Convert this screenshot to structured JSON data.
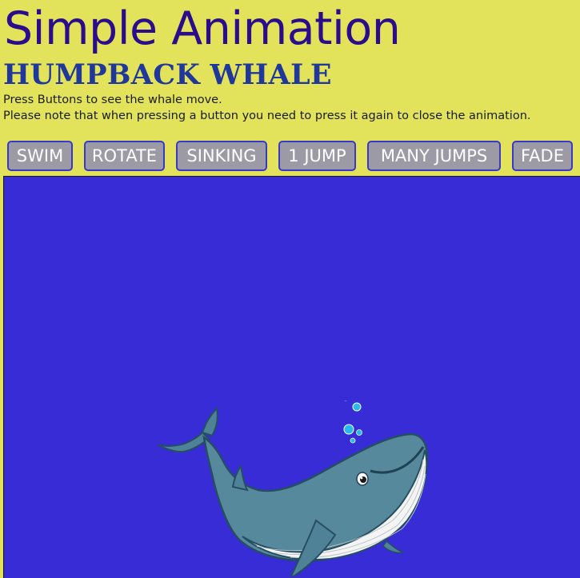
{
  "header": {
    "title": "Simple Animation",
    "subtitle": "HUMPBACK WHALE",
    "instructions": [
      "Press Buttons to see the whale move.",
      "Please note that when pressing a button you need to press it again to close the animation."
    ]
  },
  "controls": {
    "buttons": [
      {
        "label": "SWIM"
      },
      {
        "label": "ROTATE"
      },
      {
        "label": "SINKING"
      },
      {
        "label": "1 JUMP"
      },
      {
        "label": "MANY JUMPS"
      },
      {
        "label": "FADE"
      }
    ]
  },
  "stage": {
    "background_color": "#372cd6",
    "image": "humpback-whale-cartoon"
  },
  "colors": {
    "page_background": "#e2e35a",
    "title": "#2a0c8c",
    "subtitle": "#20389a",
    "button_background": "#9b9aa5",
    "button_border": "#3a38c8"
  }
}
